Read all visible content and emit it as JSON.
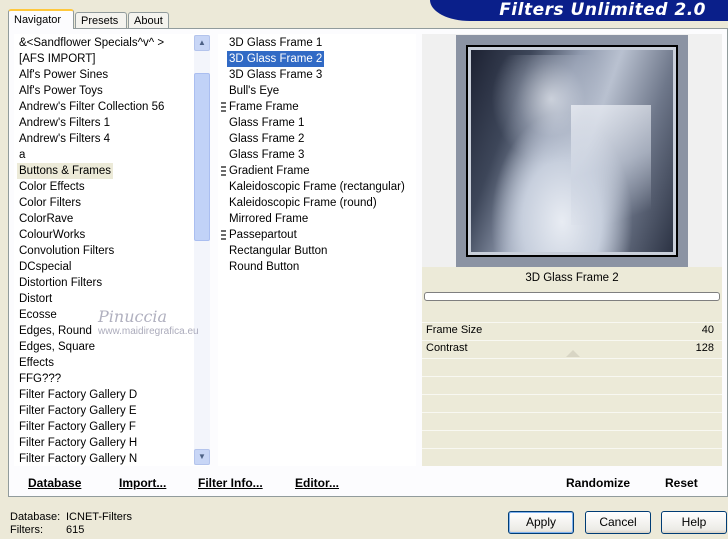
{
  "tabs": [
    "Navigator",
    "Presets",
    "About"
  ],
  "banner_title": "Filters Unlimited 2.0",
  "categories": [
    "&<Sandflower Specials^v^ >",
    "[AFS IMPORT]",
    "Alf's Power Sines",
    "Alf's Power Toys",
    "Andrew's Filter Collection 56",
    "Andrew's Filters 1",
    "Andrew's Filters 4",
    "a",
    "Buttons & Frames",
    "Color Effects",
    "Color Filters",
    "ColorRave",
    "ColourWorks",
    "Convolution Filters",
    "DCspecial",
    "Distortion Filters",
    "Distort",
    "Ecosse",
    "Edges, Round",
    "Edges, Square",
    "Effects",
    "FFG???",
    "Filter Factory Gallery D",
    "Filter Factory Gallery E",
    "Filter Factory Gallery F",
    "Filter Factory Gallery H",
    "Filter Factory Gallery N"
  ],
  "selected_category": "Buttons & Frames",
  "filters": [
    "3D Glass Frame 1",
    "3D Glass Frame 2",
    "3D Glass Frame 3",
    "Bull's Eye",
    "Frame Frame",
    "Glass Frame 1",
    "Glass Frame 2",
    "Glass Frame 3",
    "Gradient Frame",
    "Kaleidoscopic Frame (rectangular)",
    "Kaleidoscopic Frame (round)",
    "Mirrored Frame",
    "Passepartout",
    "Rectangular Button",
    "Round Button"
  ],
  "selected_filter": "3D Glass Frame 2",
  "filter_name_display": "3D Glass Frame 2",
  "sliders": [
    {
      "label": "Frame Size",
      "value": "40"
    },
    {
      "label": "Contrast",
      "value": "128"
    }
  ],
  "toolbar": {
    "database": "Database",
    "import": "Import...",
    "filter_info": "Filter Info...",
    "editor": "Editor...",
    "randomize": "Randomize",
    "reset": "Reset"
  },
  "db_info": {
    "database_label": "Database:",
    "database_value": "ICNET-Filters",
    "filters_label": "Filters:",
    "filters_value": "615"
  },
  "buttons": {
    "apply": "Apply",
    "cancel": "Cancel",
    "help": "Help"
  },
  "watermark": {
    "line1": "Pinuccia",
    "line2": "www.maidiregrafica.eu"
  },
  "colors": {
    "banner": "#0a1f8a",
    "selection": "#316ac5",
    "tab_highlight": "#ffc83c"
  }
}
